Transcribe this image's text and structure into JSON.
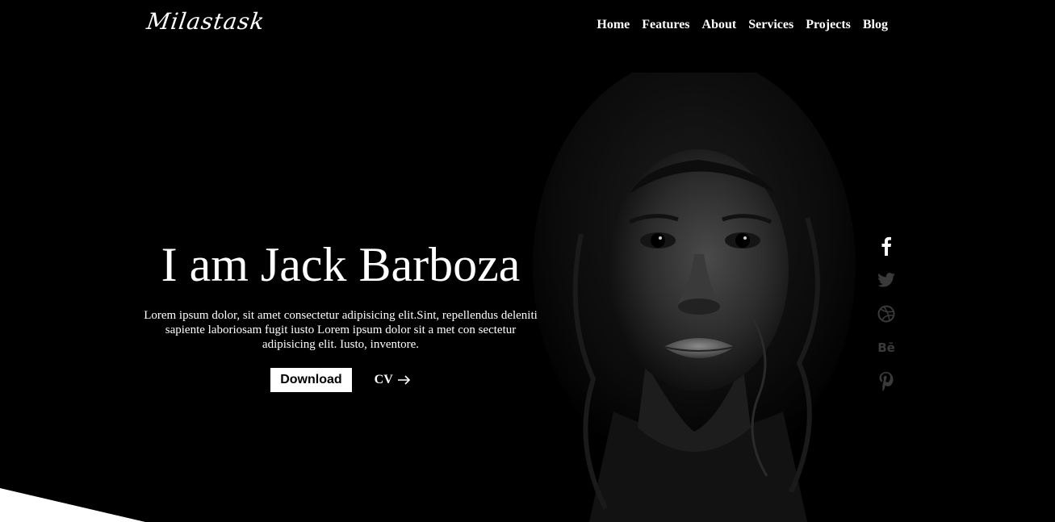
{
  "brand": {
    "logo": "Milastask"
  },
  "nav": {
    "items": [
      {
        "label": "Home"
      },
      {
        "label": "Features"
      },
      {
        "label": "About"
      },
      {
        "label": "Services"
      },
      {
        "label": "Projects"
      },
      {
        "label": "Blog"
      }
    ]
  },
  "hero": {
    "title": "I am Jack Barboza",
    "description": "Lorem ipsum dolor, sit amet consectetur adipisicing elit.Sint, repellendus deleniti sapiente laboriosam fugit iusto Lorem ipsum dolor sit a met con sectetur adipisicing elit. Iusto, inventore.",
    "download_label": "Download",
    "cv_label": "CV"
  },
  "social": {
    "icons": [
      "facebook-icon",
      "twitter-icon",
      "dribbble-icon",
      "behance-icon",
      "pinterest-icon"
    ],
    "behance_text": "Bē"
  },
  "colors": {
    "background": "#000000",
    "text": "#ffffff",
    "social_active": "#ffffff",
    "social_muted": "#3a3a3a"
  }
}
